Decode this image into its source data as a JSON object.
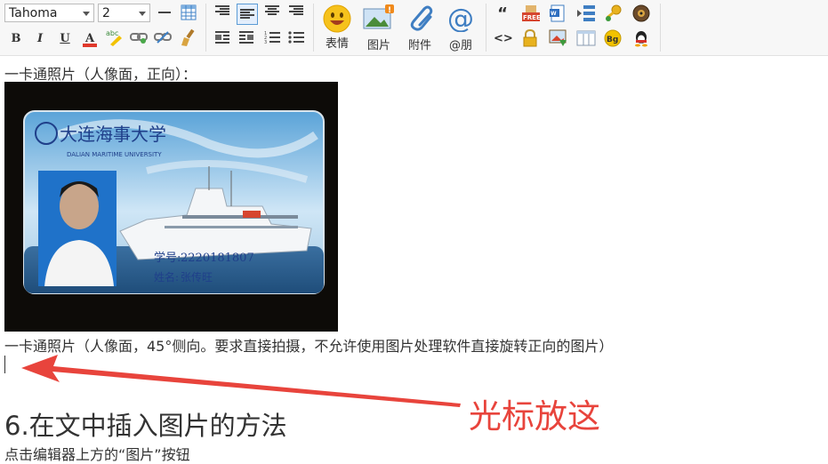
{
  "toolbar": {
    "font_select": "Tahoma",
    "size_select": "2",
    "emoji_label": "表情",
    "image_label": "图片",
    "attachment_label": "附件",
    "mention_label": "@朋",
    "free_badge": "FREE",
    "bg_badge": "Bg",
    "quote_glyph": "“",
    "code_glyph": "<>"
  },
  "content": {
    "caption_front": "一卡通照片（人像面，正向）：",
    "card": {
      "university_cn": "大连海事大学",
      "university_en": "DALIAN MARITIME UNIVERSITY",
      "student_id_label": "学号:",
      "student_id": "2220181807",
      "name_label": "姓名:",
      "name_value": "张传旺"
    },
    "caption_angle": "一卡通照片（人像面，45°侧向。要求直接拍摄，不允许使用图片处理软件直接旋转正向的图片）",
    "heading": "6.在文中插入图片的方法",
    "instruction": "点击编辑器上方的“图片”按钮"
  },
  "annotation": {
    "label": "光标放这",
    "color": "#e8443c"
  }
}
